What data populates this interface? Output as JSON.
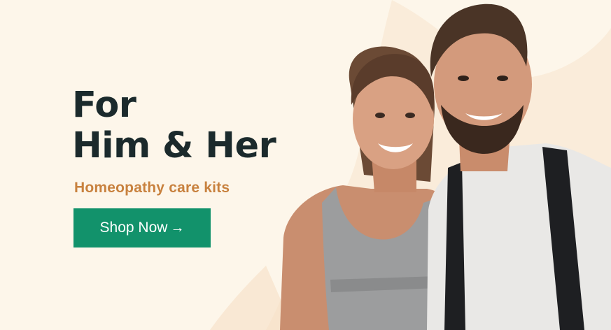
{
  "hero": {
    "headline_line1": "For",
    "headline_line2": "Him & Her",
    "subtitle": "Homeopathy care kits",
    "cta_label": "Shop Now",
    "cta_arrow": "→"
  },
  "colors": {
    "background": "#fdf6ea",
    "headline": "#1b2a2c",
    "subtitle": "#c8813e",
    "cta_background": "#12926b",
    "cta_text": "#ffffff"
  }
}
